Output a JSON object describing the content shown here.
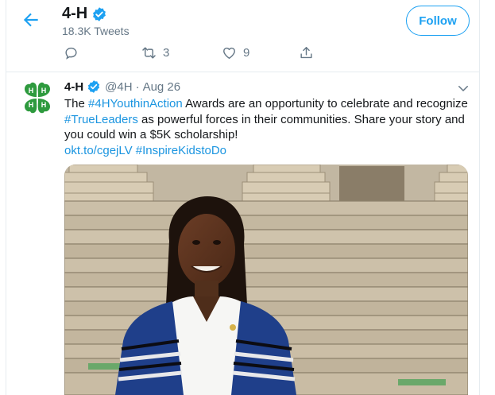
{
  "header": {
    "account_name": "4-H",
    "tweet_count": "18.3K Tweets",
    "follow_label": "Follow"
  },
  "prev_tweet_actions": {
    "retweets": "3",
    "likes": "9"
  },
  "tweet": {
    "name": "4-H",
    "handle": "@4H",
    "separator": "·",
    "date": "Aug 26",
    "text": {
      "p1": "The ",
      "hashtag1": "#4HYouthinAction",
      "p2": " Awards are an opportunity to celebrate and recognize ",
      "hashtag2": "#TrueLeaders",
      "p3": " as powerful forces in their communities. Share your story and you could win a $5K scholarship!",
      "link": "okt.to/cgejLV",
      "hashtag3": "#InspireKidstoDo"
    }
  },
  "colors": {
    "accent": "#1da1f2",
    "link": "#1b95e0",
    "secondary_text": "#657786",
    "clover_green": "#2e9a3e"
  },
  "icons": [
    "back-arrow-icon",
    "verified-badge-icon",
    "reply-icon",
    "retweet-icon",
    "like-icon",
    "share-icon",
    "chevron-down-icon",
    "4h-clover-logo"
  ]
}
